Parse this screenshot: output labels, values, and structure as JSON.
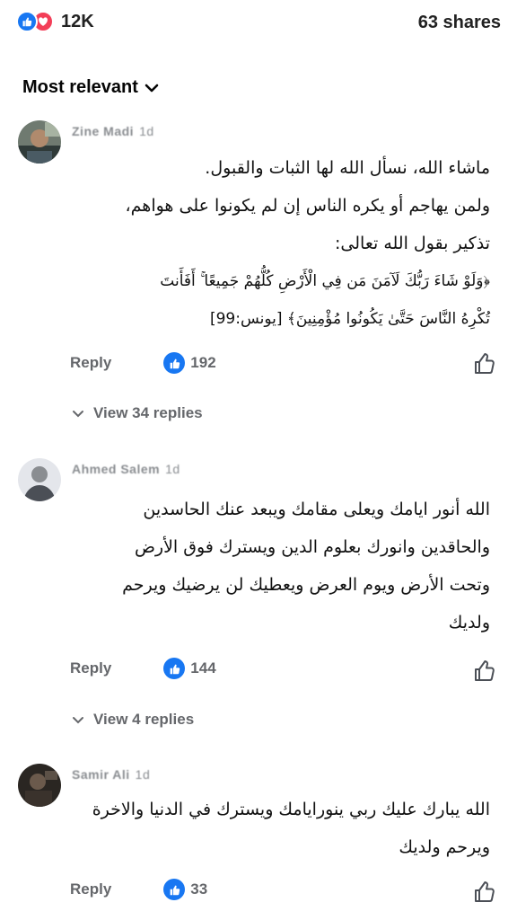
{
  "header": {
    "reactions_count": "12K",
    "shares": "63 shares"
  },
  "sort": {
    "label": "Most relevant"
  },
  "comments": [
    {
      "author": "Zine Madi",
      "time": "1d",
      "lines": [
        "ماشاء الله، نسأل الله لها الثبات والقبول.",
        "ولمن يهاجم أو يكره الناس إن لم يكونوا على هواهم،",
        "تذكير بقول الله تعالى:",
        "﴿وَلَوْ شَاءَ رَبُّكَ لَآمَنَ مَن فِي الْأَرْضِ كُلُّهُمْ جَمِيعًا ۚ أَفَأَنتَ",
        "تُكْرِهُ النَّاسَ حَتَّىٰ يَكُونُوا مُؤْمِنِينَ﴾ [يونس:99]"
      ],
      "reply_label": "Reply",
      "like_count": "192",
      "view_replies": "View 34 replies"
    },
    {
      "author": "Ahmed Salem",
      "time": "1d",
      "lines": [
        "الله أنور ايامك ويعلى مقامك ويبعد عنك الحاسدين",
        "والحاقدين وانورك  بعلوم الدين   ويسترك فوق الأرض",
        "وتحت الأرض ويوم العرض ويعطيك لن يرضيك ويرحم",
        "ولديك"
      ],
      "reply_label": "Reply",
      "like_count": "144",
      "view_replies": "View 4 replies"
    },
    {
      "author": "Samir Ali",
      "time": "1d",
      "lines": [
        "الله يبارك عليك ربي ينورايامك ويسترك في الدنيا والاخرة",
        "ويرحم ولديك"
      ],
      "reply_label": "Reply",
      "like_count": "33"
    }
  ],
  "colors": {
    "like_blue": "#1877f2",
    "love_red": "#f33e58",
    "secondary_text": "#65676b"
  }
}
